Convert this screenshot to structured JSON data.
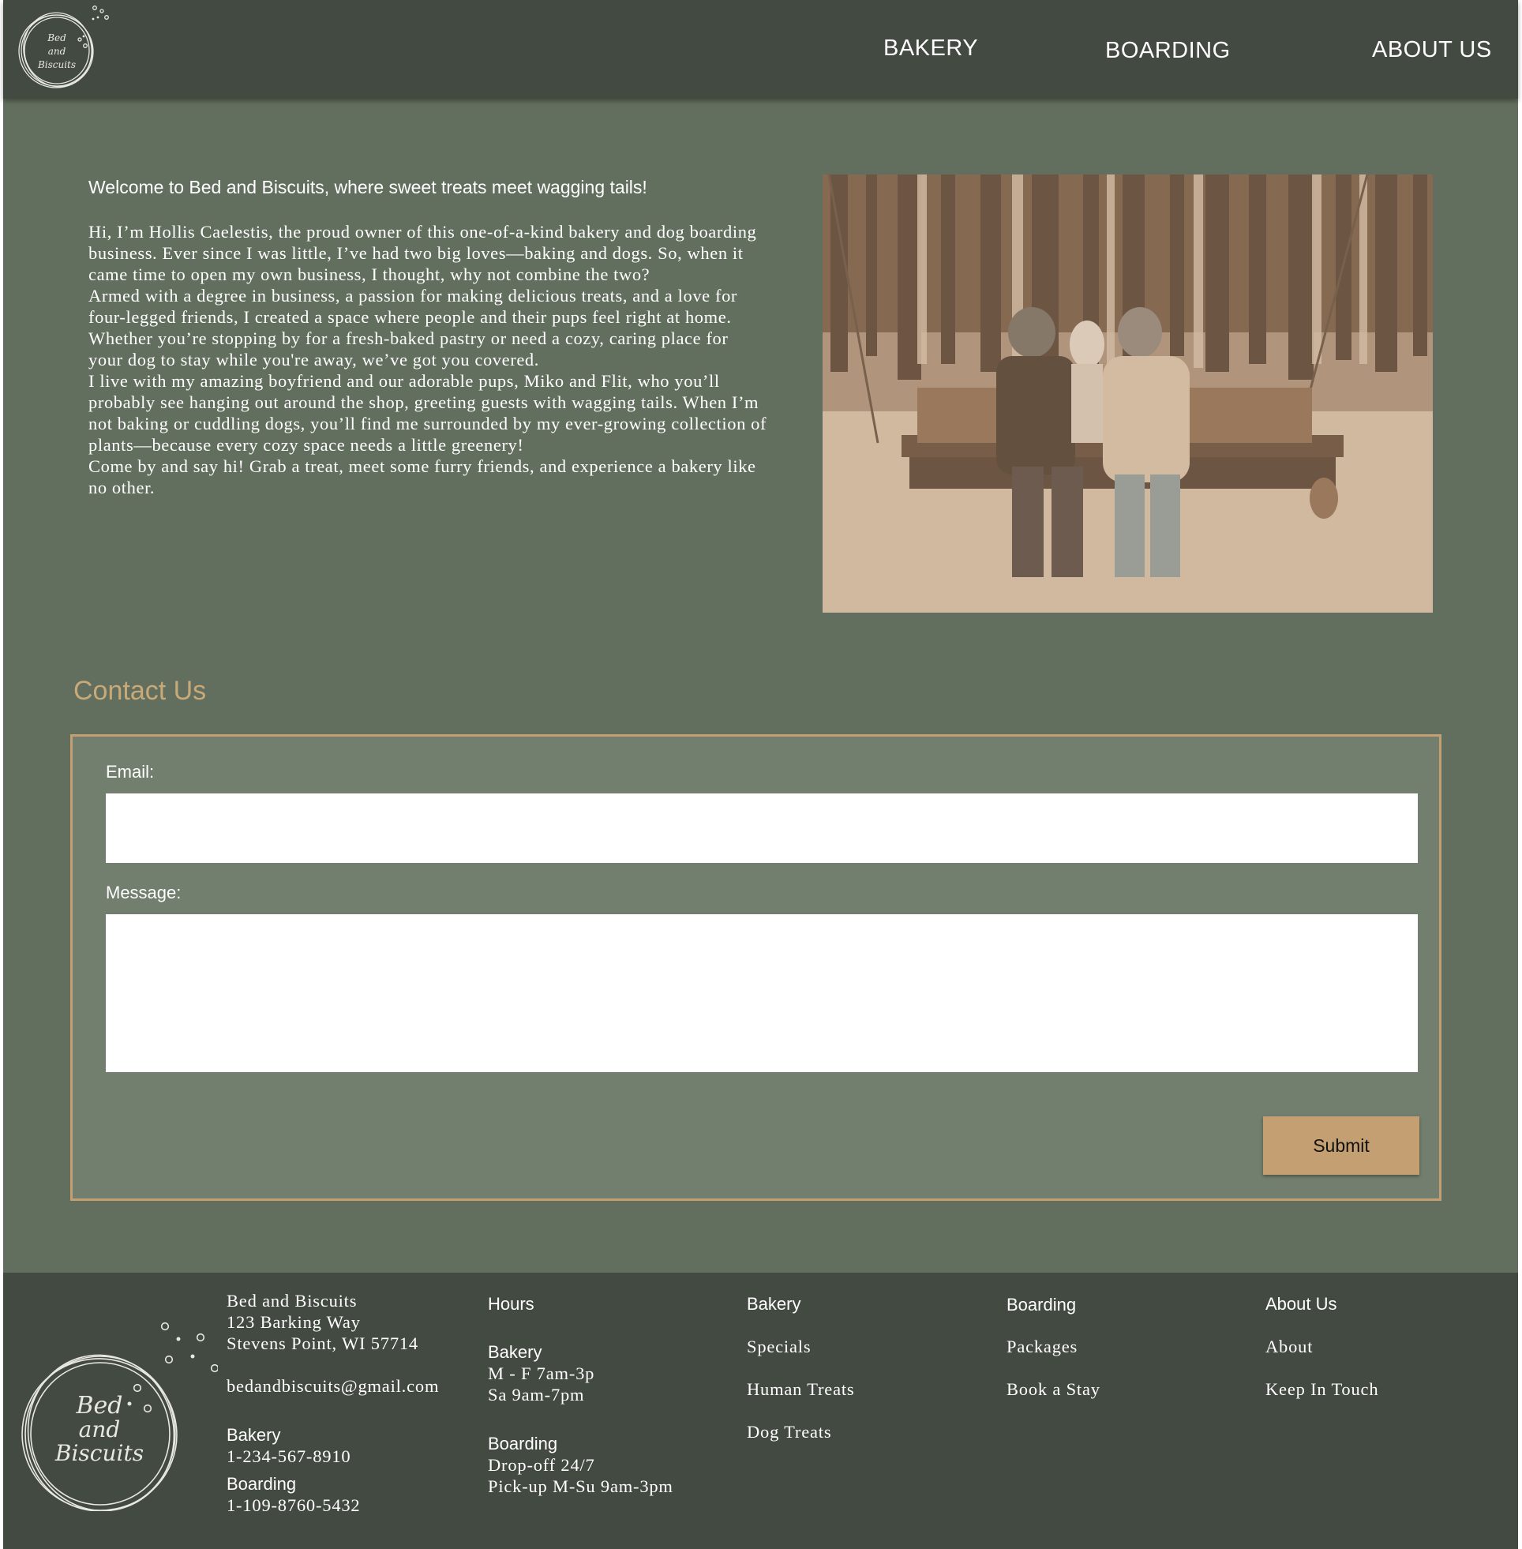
{
  "brand": {
    "logo_lines": [
      "Bed",
      "and",
      "Biscuits"
    ]
  },
  "nav": {
    "bakery": "BAKERY",
    "boarding": "BOARDING",
    "about": "ABOUT US"
  },
  "intro": {
    "heading": "Welcome to Bed and Biscuits, where sweet treats meet wagging tails!",
    "paragraphs": [
      "Hi, I’m Hollis Caelestis, the proud owner of this one-of-a-kind bakery and dog boarding business. Ever since I was little, I’ve had two big loves—baking and dogs. So, when it came time to open my own business, I thought, why not combine the two?",
      "Armed with a degree in business, a passion for making delicious treats, and a love for four-legged friends, I created a space where people and their pups feel right at home. Whether you’re stopping by for a fresh-baked pastry or need a cozy, caring place for your dog to stay while you're away, we’ve got you covered.",
      "I live with my amazing boyfriend and our adorable pups, Miko and Flit, who you’ll probably see hanging out around the shop, greeting guests with wagging tails. When I’m not baking or cuddling dogs, you’ll find me surrounded by my ever-growing collection of plants—because every cozy space needs a little greenery!",
      "Come by and say hi! Grab a treat, meet some furry friends, and experience a bakery like no other."
    ]
  },
  "contact": {
    "title": "Contact Us",
    "email_label": "Email:",
    "email_value": "",
    "message_label": "Message:",
    "message_value": "",
    "submit_label": "Submit"
  },
  "footer": {
    "address": [
      "Bed and Biscuits",
      "123 Barking Way",
      "Stevens Point, WI 57714"
    ],
    "email": "bedandbiscuits@gmail.com",
    "phones": {
      "bakery_label": "Bakery",
      "bakery_number": "1-234-567-8910",
      "boarding_label": "Boarding",
      "boarding_number": "1-109-8760-5432"
    },
    "hours": {
      "title": "Hours",
      "bakery_label": "Bakery",
      "bakery_lines": [
        "M - F 7am-3p",
        "Sa 9am-7pm"
      ],
      "boarding_label": "Boarding",
      "boarding_lines": [
        "Drop-off 24/7",
        "Pick-up M-Su 9am-3pm"
      ]
    },
    "bakery_col": {
      "title": "Bakery",
      "links": [
        "Specials",
        "Human Treats",
        "Dog Treats"
      ]
    },
    "boarding_col": {
      "title": "Boarding",
      "links": [
        "Packages",
        "Book a Stay"
      ]
    },
    "about_col": {
      "title": "About Us",
      "links": [
        "About",
        "Keep In Touch"
      ]
    }
  },
  "colors": {
    "header_bg": "#434a41",
    "page_bg": "#636f5e",
    "form_bg": "#737f6e",
    "accent": "#c49f72",
    "contact_title": "#c8a978"
  }
}
